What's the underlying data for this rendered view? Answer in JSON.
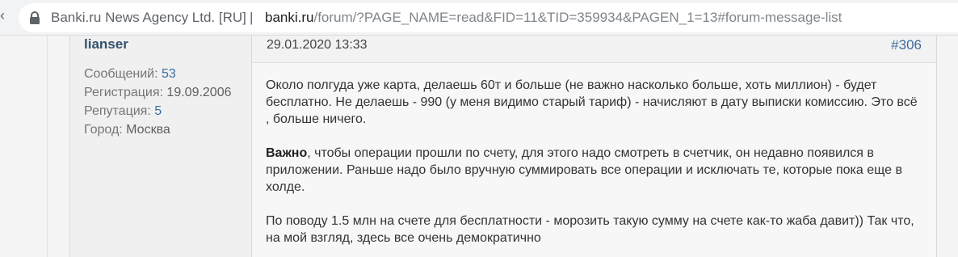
{
  "browser": {
    "site_identity": "Banki.ru News Agency Ltd. [RU]",
    "separator": "|",
    "url_host": "banki.ru",
    "url_path": "/forum/?PAGE_NAME=read&FID=11&TID=359934&PAGEN_1=13#forum-message-list"
  },
  "post": {
    "author": {
      "name": "lianser",
      "messages_label": "Сообщений: ",
      "messages_value": "53",
      "registration_label": "Регистрация: ",
      "registration_value": "19.09.2006",
      "reputation_label": "Репутация: ",
      "reputation_value": "5",
      "city_label": "Город: ",
      "city_value": "Москва"
    },
    "date": "29.01.2020 13:33",
    "number": "#306",
    "paragraphs": [
      {
        "bold": "",
        "text": "Около полгуда уже карта, делаешь 60т и больше (не важно насколько больше, хоть миллион) - будет бесплатно. Не делаешь - 990 (у меня видимо старый тариф) - начисляют в дату выписки комиссию. Это всё , больше ничего."
      },
      {
        "bold": "Важно",
        "text": ", чтобы операции прошли по счету, для этого надо смотреть в счетчик, он недавно появился в приложении. Раньше надо было вручную суммировать все операции и исключать те, которые пока еще в холде."
      },
      {
        "bold": "",
        "text": "По поводу 1.5 млн на счете для бесплатности - морозить такую сумму на счете как-то жаба давит)) Так что, на мой взгляд, здесь все очень демократично"
      }
    ]
  }
}
